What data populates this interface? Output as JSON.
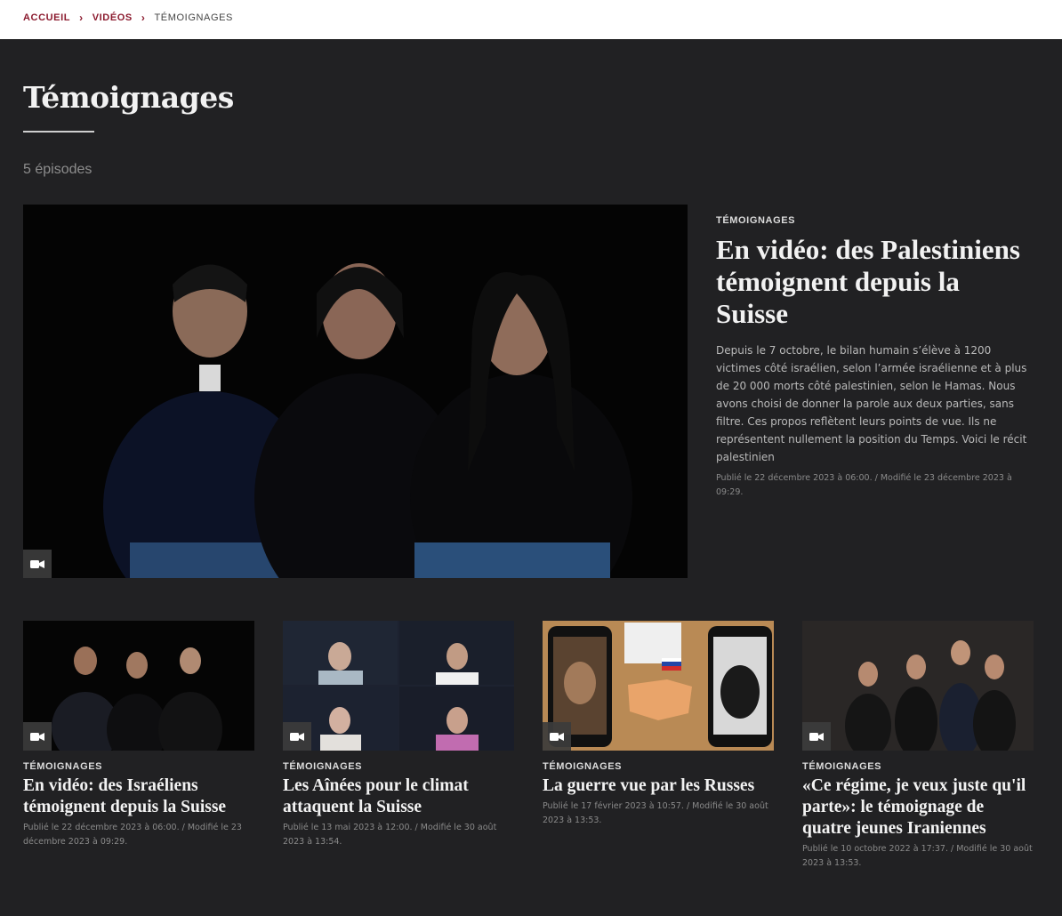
{
  "breadcrumb": {
    "home": "ACCUEIL",
    "videos": "VIDÉOS",
    "current": "TÉMOIGNAGES"
  },
  "header": {
    "title": "Témoignages",
    "episode_count": "5 épisodes"
  },
  "featured": {
    "kicker": "TÉMOIGNAGES",
    "title": "En vidéo: des Palestiniens témoignent depuis la Suisse",
    "summary": "Depuis le 7 octobre, le bilan humain s’élève à 1200 victimes côté israélien, selon l’armée israélienne et à plus de 20 000 morts côté palestinien, selon le Hamas. Nous avons choisi de donner la parole aux deux parties, sans filtre. Ces propos reflètent leurs points de vue. Ils ne représentent nullement la position du Temps. Voici le récit palestinien",
    "meta": "Publié le 22 décembre 2023 à 06:00. / Modifié le 23 décembre 2023 à 09:29.",
    "media_icon": "video-camera-icon"
  },
  "cards": [
    {
      "kicker": "TÉMOIGNAGES",
      "title": "En vidéo: des Israéliens témoignent depuis la Suisse",
      "meta": "Publié le 22 décembre 2023 à 06:00. / Modifié le 23 décembre 2023 à 09:29."
    },
    {
      "kicker": "TÉMOIGNAGES",
      "title": "Les Aînées pour le climat attaquent la Suisse",
      "meta": "Publié le 13 mai 2023 à 12:00. / Modifié le 30 août 2023 à 13:54."
    },
    {
      "kicker": "TÉMOIGNAGES",
      "title": "La guerre vue par les Russes",
      "meta": "Publié le 17 février 2023 à 10:57. / Modifié le 30 août 2023 à 13:53."
    },
    {
      "kicker": "TÉMOIGNAGES",
      "title": "«Ce régime, je veux juste qu'il parte»: le témoignage de quatre jeunes Iraniennes",
      "meta": "Publié le 10 octobre 2022 à 17:37. / Modifié le 30 août 2023 à 13:53."
    }
  ],
  "colors": {
    "accent": "#8b1a2e",
    "background": "#212123"
  }
}
